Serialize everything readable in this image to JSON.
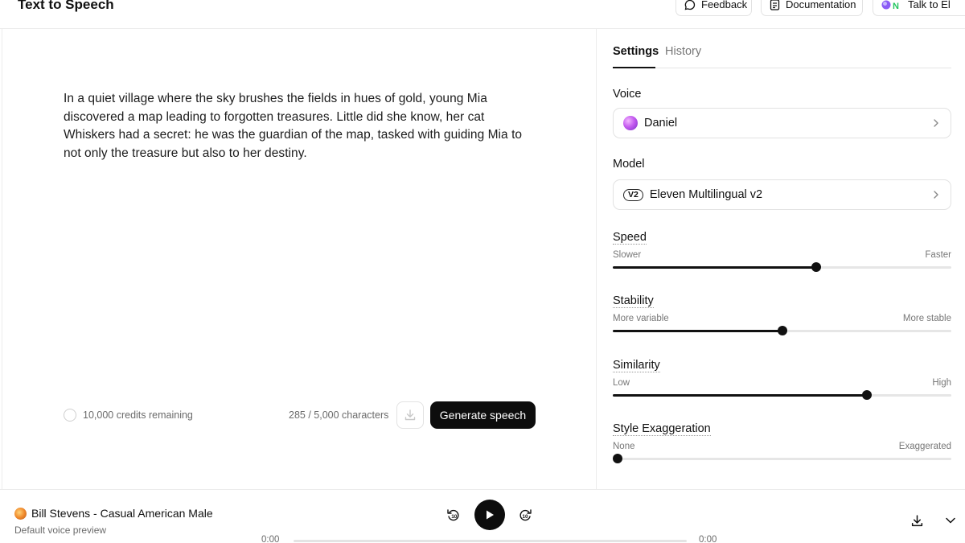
{
  "header": {
    "title": "Text to Speech",
    "feedback_label": "Feedback",
    "docs_label": "Documentation",
    "talk_label": "Talk to El"
  },
  "editor": {
    "text": "In a quiet village where the sky brushes the fields in hues of gold, young Mia discovered a map leading to forgotten treasures. Little did she know, her cat Whiskers had a secret: he was the guardian of the map, tasked with guiding Mia to not only the treasure but also to her destiny."
  },
  "footer": {
    "credits": "10,000 credits remaining",
    "char_count": "285 / 5,000 characters",
    "generate_label": "Generate speech"
  },
  "settings": {
    "tabs": [
      "Settings",
      "History"
    ],
    "voice_label": "Voice",
    "voice_value": "Daniel",
    "model_label": "Model",
    "model_badge": "V2",
    "model_value": "Eleven Multilingual v2",
    "sliders": [
      {
        "label": "Speed",
        "low": "Slower",
        "high": "Faster",
        "value": 0.6
      },
      {
        "label": "Stability",
        "low": "More variable",
        "high": "More stable",
        "value": 0.5
      },
      {
        "label": "Similarity",
        "low": "Low",
        "high": "High",
        "value": 0.75
      },
      {
        "label": "Style Exaggeration",
        "low": "None",
        "high": "Exaggerated",
        "value": 0.0
      }
    ]
  },
  "player": {
    "title": "Bill Stevens - Casual American Male",
    "subtitle": "Default voice preview",
    "time_current": "0:00",
    "time_total": "0:00",
    "progress": 0.0
  }
}
